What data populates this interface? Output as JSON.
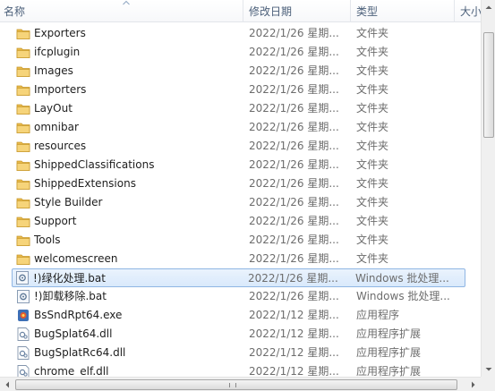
{
  "header": {
    "name_label": "名称",
    "date_label": "修改日期",
    "type_label": "类型",
    "size_label": "大小"
  },
  "files": [
    {
      "name": "Exporters",
      "date": "2022/1/26 星期...",
      "type": "文件夹",
      "icon": "folder-icon"
    },
    {
      "name": "ifcplugin",
      "date": "2022/1/26 星期...",
      "type": "文件夹",
      "icon": "folder-icon"
    },
    {
      "name": "Images",
      "date": "2022/1/26 星期...",
      "type": "文件夹",
      "icon": "folder-icon"
    },
    {
      "name": "Importers",
      "date": "2022/1/26 星期...",
      "type": "文件夹",
      "icon": "folder-icon"
    },
    {
      "name": "LayOut",
      "date": "2022/1/26 星期...",
      "type": "文件夹",
      "icon": "folder-icon"
    },
    {
      "name": "omnibar",
      "date": "2022/1/26 星期...",
      "type": "文件夹",
      "icon": "folder-icon"
    },
    {
      "name": "resources",
      "date": "2022/1/26 星期...",
      "type": "文件夹",
      "icon": "folder-icon"
    },
    {
      "name": "ShippedClassifications",
      "date": "2022/1/26 星期...",
      "type": "文件夹",
      "icon": "folder-icon"
    },
    {
      "name": "ShippedExtensions",
      "date": "2022/1/26 星期...",
      "type": "文件夹",
      "icon": "folder-icon"
    },
    {
      "name": "Style Builder",
      "date": "2022/1/26 星期...",
      "type": "文件夹",
      "icon": "folder-icon"
    },
    {
      "name": "Support",
      "date": "2022/1/26 星期...",
      "type": "文件夹",
      "icon": "folder-icon"
    },
    {
      "name": "Tools",
      "date": "2022/1/26 星期...",
      "type": "文件夹",
      "icon": "folder-icon"
    },
    {
      "name": "welcomescreen",
      "date": "2022/1/26 星期...",
      "type": "文件夹",
      "icon": "folder-icon"
    },
    {
      "name": "!)绿化处理.bat",
      "date": "2022/1/26 星期...",
      "type": "Windows 批处理...",
      "icon": "batch-file-icon",
      "selected": true
    },
    {
      "name": "!)卸载移除.bat",
      "date": "2022/1/26 星期...",
      "type": "Windows 批处理...",
      "icon": "batch-file-icon"
    },
    {
      "name": "BsSndRpt64.exe",
      "date": "2022/1/12 星期...",
      "type": "应用程序",
      "icon": "application-icon"
    },
    {
      "name": "BugSplat64.dll",
      "date": "2022/1/12 星期...",
      "type": "应用程序扩展",
      "icon": "dll-file-icon"
    },
    {
      "name": "BugSplatRc64.dll",
      "date": "2022/1/12 星期...",
      "type": "应用程序扩展",
      "icon": "dll-file-icon"
    },
    {
      "name": "chrome_elf.dll",
      "date": "2022/1/12 星期...",
      "type": "应用程序扩展",
      "icon": "dll-file-icon"
    }
  ],
  "colors": {
    "folder": "#e8b84a",
    "selection_bg": "#d9e9fb",
    "selection_border": "#90b6e4",
    "header_text": "#4c607a",
    "meta_text": "#6d6d6d"
  }
}
